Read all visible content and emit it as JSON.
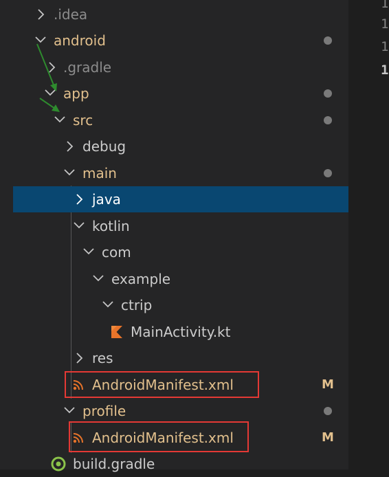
{
  "editor": {
    "line_numbers": [
      "1",
      "1",
      "1",
      "1"
    ]
  },
  "tree": {
    "idea": ".idea",
    "android": "android",
    "gradle": ".gradle",
    "app": "app",
    "src": "src",
    "debug": "debug",
    "main": "main",
    "java": "java",
    "kotlin": "kotlin",
    "com": "com",
    "example": "example",
    "ctrip": "ctrip",
    "main_activity": "MainActivity.kt",
    "res": "res",
    "manifest_main": "AndroidManifest.xml",
    "manifest_main_status": "M",
    "profile": "profile",
    "manifest_profile": "AndroidManifest.xml",
    "manifest_profile_status": "M",
    "build_gradle": "build.gradle"
  },
  "colors": {
    "modified": "#e2c08d",
    "selection": "#094771",
    "annotation_red": "#e53935",
    "annotation_green": "#2e8b2e"
  },
  "icons": {
    "kotlin_file": "kotlin-icon",
    "xml_file": "rss-icon",
    "gradle_file": "gradle-icon"
  }
}
